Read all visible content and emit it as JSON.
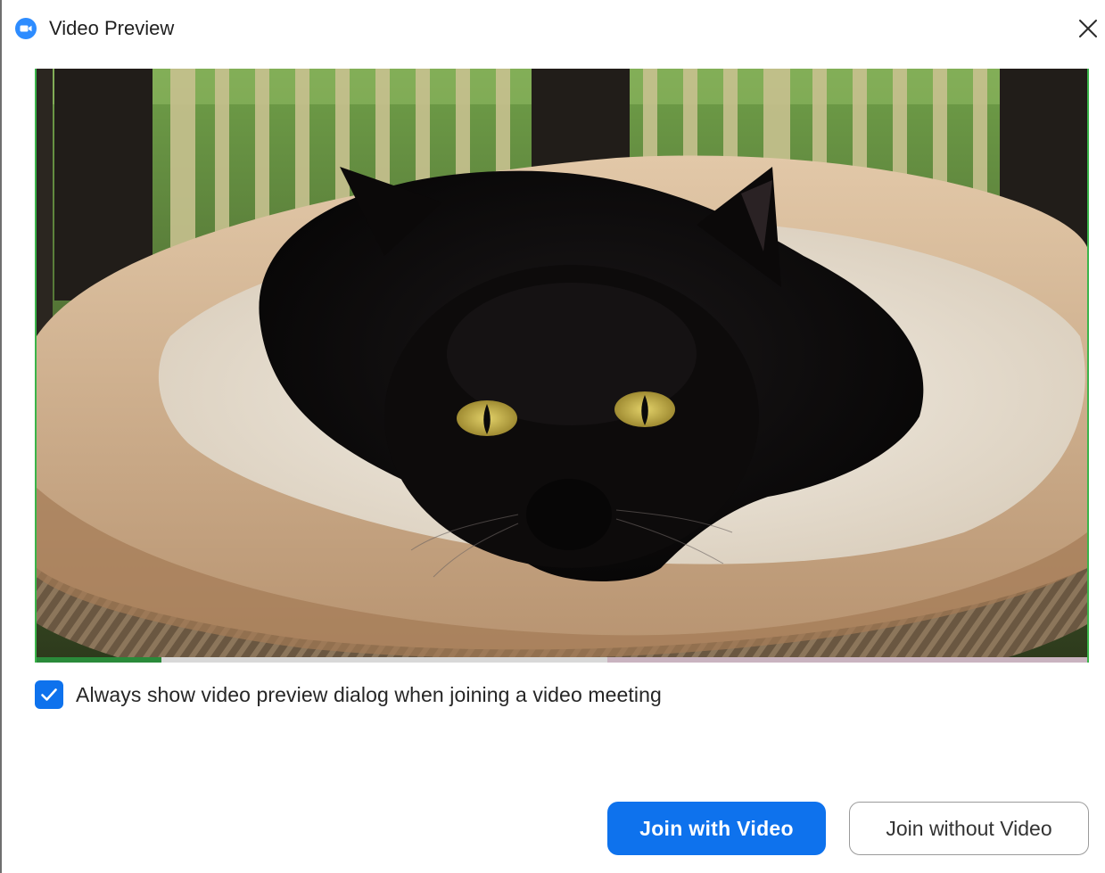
{
  "window": {
    "title": "Video Preview",
    "icon": "zoom-camera-icon",
    "close_icon": "close-icon"
  },
  "preview": {
    "description_icon": "camera-feed",
    "accent_border_color": "#3bb44a"
  },
  "option": {
    "label": "Always show video preview dialog when joining a video meeting",
    "checked": true
  },
  "actions": {
    "join_with_video": "Join with Video",
    "join_without_video": "Join without Video"
  },
  "colors": {
    "brand_blue": "#0e72ed",
    "zoom_icon_blue": "#2d8cff"
  }
}
